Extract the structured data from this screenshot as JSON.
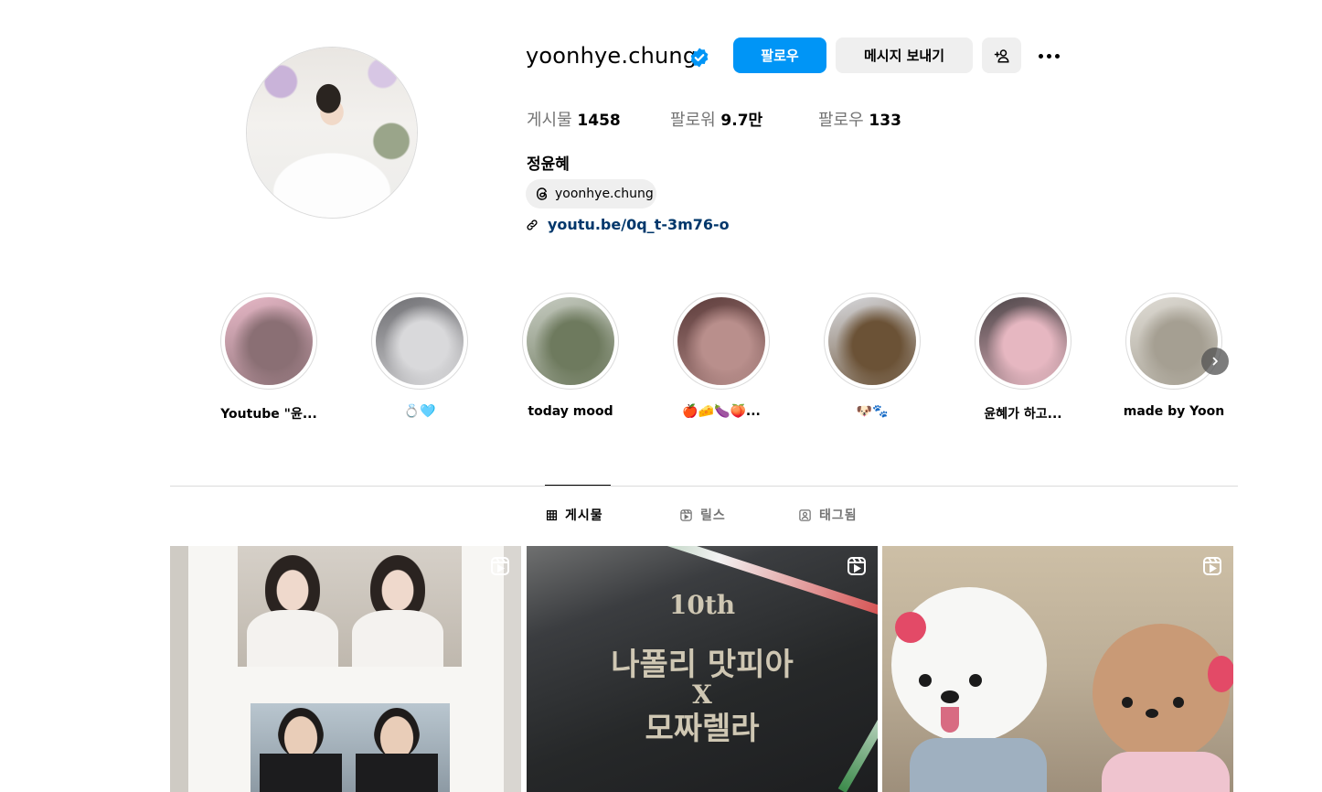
{
  "profile": {
    "username": "yoonhye.chung",
    "verified": true,
    "follow_label": "팔로우",
    "message_label": "메시지 보내기",
    "add_user_icon": "person-add-icon",
    "more_icon": "more-horizontal-icon",
    "stats": {
      "posts_label": "게시물",
      "posts_value": "1458",
      "followers_label": "팔로워",
      "followers_value": "9.7만",
      "following_label": "팔로우",
      "following_value": "133"
    },
    "full_name": "정윤혜",
    "threads_handle": "yoonhye.chung",
    "link": "youtu.be/0q_t-3m76-o"
  },
  "highlights": [
    {
      "label": "Youtube \"윤...",
      "colors": [
        "#e8b9c8",
        "#8a6f74"
      ]
    },
    {
      "label": "💍🩵",
      "colors": [
        "#6c6c70",
        "#d9d9db"
      ]
    },
    {
      "label": "today mood",
      "colors": [
        "#c7ccc2",
        "#6e7a5e"
      ]
    },
    {
      "label": "🍎🧀🍆🍑...",
      "colors": [
        "#5b3b3a",
        "#b98f8c"
      ]
    },
    {
      "label": "🐶🐾",
      "colors": [
        "#d9dbe0",
        "#6b5236"
      ]
    },
    {
      "label": "윤혜가 하고...",
      "colors": [
        "#4a4346",
        "#e6b7c1"
      ]
    },
    {
      "label": "made by Yoon",
      "colors": [
        "#dfdcd5",
        "#a59f92"
      ]
    }
  ],
  "tabs": [
    {
      "label": "게시물",
      "icon": "grid-icon",
      "active": true
    },
    {
      "label": "릴스",
      "icon": "reels-icon",
      "active": false
    },
    {
      "label": "태그됨",
      "icon": "tagged-icon",
      "active": false
    }
  ],
  "posts": [
    {
      "type": "reel",
      "subject": "wedding-photo-frames"
    },
    {
      "type": "reel",
      "subject": "box-with-korean-text",
      "text_small": "10th",
      "text_line1": "나폴리 맛피아",
      "text_x": "X",
      "text_line2": "모짜렐라"
    },
    {
      "type": "reel",
      "subject": "two-dogs-in-hanbok"
    }
  ],
  "colors": {
    "primary_button": "#0095f6",
    "secondary_button": "#efefef",
    "link": "#00376b",
    "muted_text": "#737373",
    "divider": "#dbdbdb"
  }
}
